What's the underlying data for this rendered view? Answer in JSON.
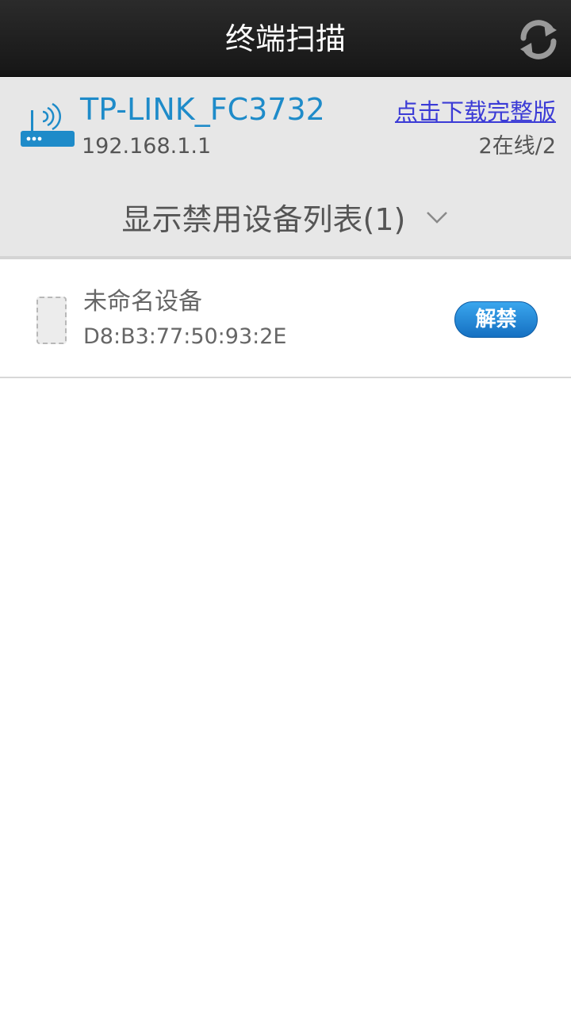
{
  "header": {
    "title": "终端扫描",
    "refresh_icon": "refresh-icon"
  },
  "router": {
    "icon": "router-wifi-icon",
    "name": "TP-LINK_FC3732",
    "ip": "192.168.1.1",
    "download_link": "点击下载完整版",
    "online_count": "2在线/2",
    "accent_color": "#1e8bc9"
  },
  "banned_toggle": {
    "label": "显示禁用设备列表(1)",
    "icon": "chevron-down-icon"
  },
  "devices": [
    {
      "icon": "device-icon",
      "name": "未命名设备",
      "mac": "D8:B3:77:50:93:2E",
      "action_label": "解禁"
    }
  ]
}
